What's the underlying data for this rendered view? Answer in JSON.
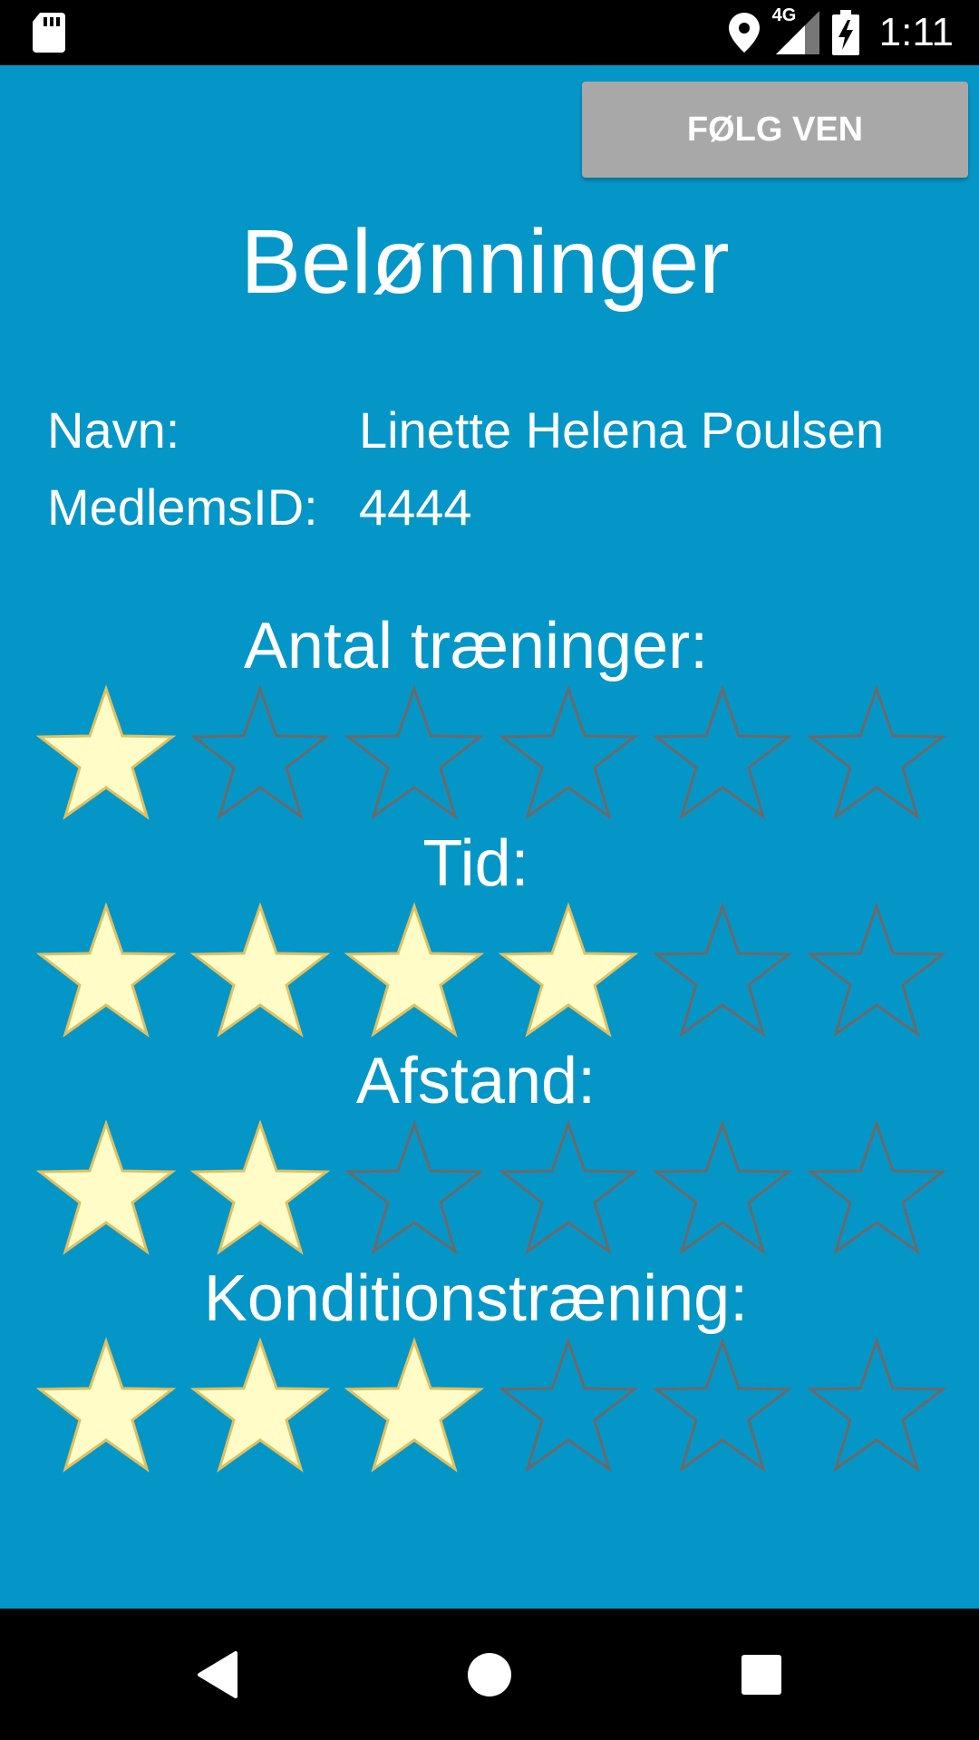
{
  "status_bar": {
    "time": "1:11",
    "network": "4G",
    "icons": [
      "sd-card-icon",
      "location-icon",
      "signal-icon",
      "battery-charging-icon"
    ]
  },
  "header": {
    "follow_button": "FØLG VEN",
    "title": "Belønninger"
  },
  "profile": {
    "name_label": "Navn:",
    "name_value": "Linette Helena Poulsen",
    "id_label": "MedlemsID:",
    "id_value": "4444"
  },
  "ratings": [
    {
      "label": "Antal træninger:",
      "filled": 1,
      "max": 6
    },
    {
      "label": "Tid:",
      "filled": 4,
      "max": 6
    },
    {
      "label": "Afstand:",
      "filled": 2,
      "max": 6
    },
    {
      "label": "Konditionstræning:",
      "filled": 3,
      "max": 6
    }
  ],
  "colors": {
    "background": "#0596C8",
    "star_filled": "#FFFCC8",
    "star_filled_outline": "#E0C060",
    "star_empty_outline": "#6A6A6A",
    "button": "#A8A8A8"
  },
  "nav_bar": {
    "icons": [
      "back-icon",
      "home-icon",
      "recents-icon"
    ]
  }
}
